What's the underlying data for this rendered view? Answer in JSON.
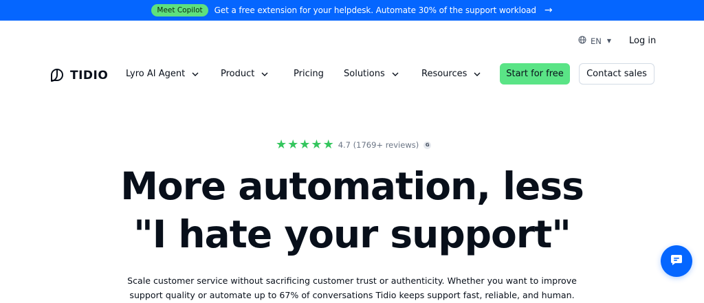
{
  "banner": {
    "pill": "Meet Copilot",
    "text": "Get a free extension for your helpdesk. Automate 30% of the support workload",
    "arrow": "→"
  },
  "topbar": {
    "language": "EN",
    "login": "Log in"
  },
  "nav": {
    "logo_text": "TIDIO",
    "items": [
      {
        "label": "Lyro AI Agent",
        "has_dropdown": true
      },
      {
        "label": "Product",
        "has_dropdown": true
      },
      {
        "label": "Pricing",
        "has_dropdown": false
      },
      {
        "label": "Solutions",
        "has_dropdown": true
      },
      {
        "label": "Resources",
        "has_dropdown": true
      }
    ],
    "start_button": "Start for free",
    "contact_button": "Contact sales"
  },
  "hero": {
    "rating_value": "4.7 (1769+ reviews)",
    "stars": 5,
    "headline_line1": "More automation, less",
    "headline_line2": "\"I hate your support\"",
    "subtitle_line1": "Scale customer service without sacrificing customer trust or authenticity. Whether you want to improve",
    "subtitle_line2": "support quality or automate up to 67% of conversations Tidio keeps support fast, reliable, and human."
  },
  "colors": {
    "banner": "#0566ff",
    "cta": "#5ae486",
    "stars": "#35c65e",
    "text": "#080f1a"
  },
  "icons": [
    "globe-icon",
    "caret-down-icon",
    "tidio-logo-icon",
    "chevron-down-icon",
    "star-icon",
    "g2-badge-icon",
    "chat-bubble-icon",
    "arrow-right-icon"
  ]
}
